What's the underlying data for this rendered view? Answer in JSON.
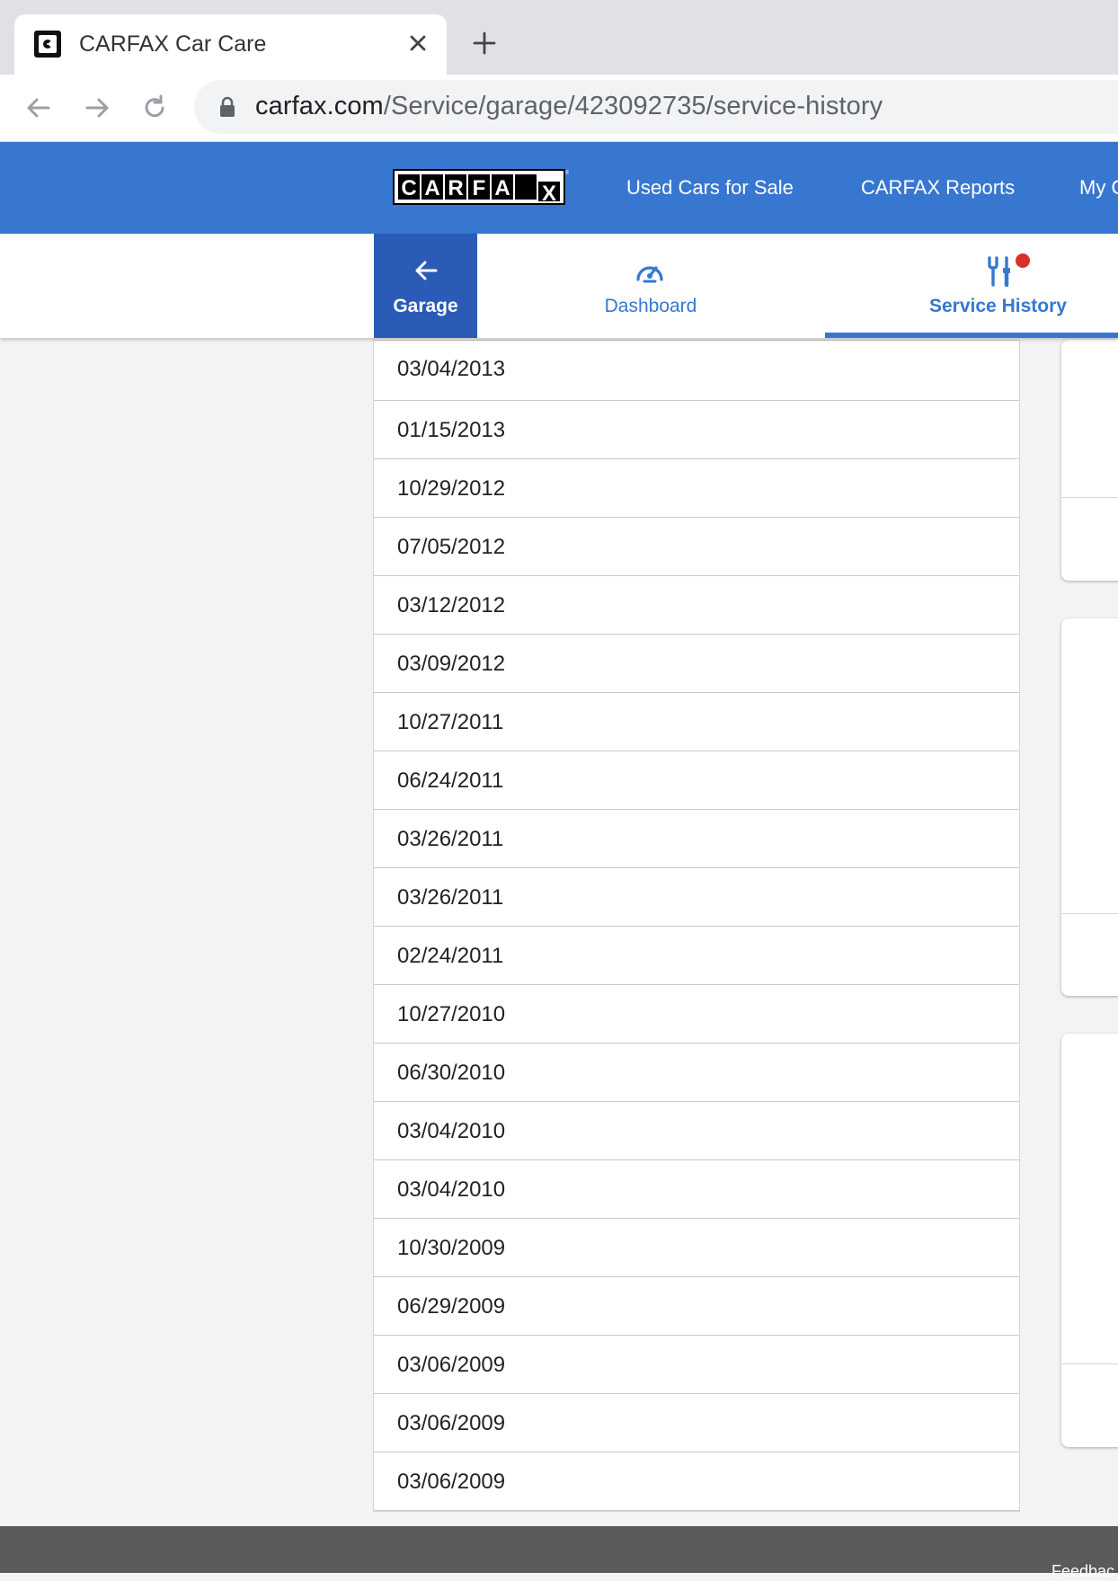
{
  "browser": {
    "tab_title": "CARFAX Car Care",
    "url_host": "carfax.com",
    "url_path": "/Service/garage/423092735/service-history"
  },
  "header": {
    "logo_text": "CARFAX",
    "nav": [
      "Used Cars for Sale",
      "CARFAX Reports",
      "My C"
    ]
  },
  "subnav": {
    "garage_label": "Garage",
    "dashboard_label": "Dashboard",
    "service_history_label": "Service History"
  },
  "service_dates": [
    "03/04/2013",
    "01/15/2013",
    "10/29/2012",
    "07/05/2012",
    "03/12/2012",
    "03/09/2012",
    "10/27/2011",
    "06/24/2011",
    "03/26/2011",
    "03/26/2011",
    "02/24/2011",
    "10/27/2010",
    "06/30/2010",
    "03/04/2010",
    "03/04/2010",
    "10/30/2009",
    "06/29/2009",
    "03/06/2009",
    "03/06/2009",
    "03/06/2009"
  ],
  "footer": {
    "feedback": "Feedbac"
  },
  "colors": {
    "brand_blue": "#3777d0",
    "garage_blue": "#2a5bb7",
    "notification_red": "#d7312a"
  }
}
